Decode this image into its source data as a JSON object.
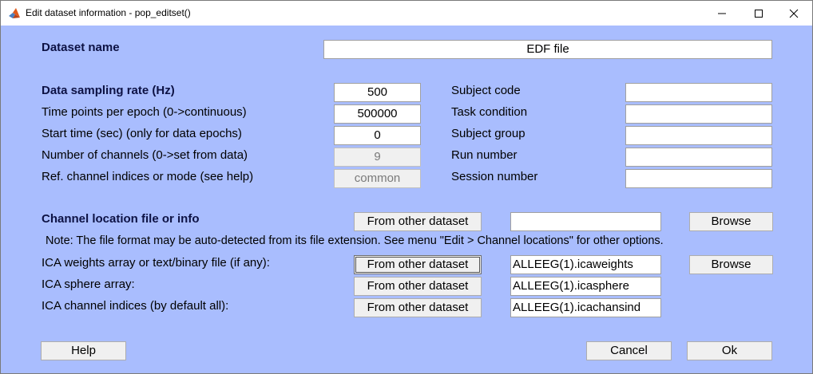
{
  "window": {
    "title": "Edit dataset information - pop_editset()"
  },
  "dataset_name": {
    "label": "Dataset name",
    "value": "EDF file"
  },
  "params": [
    {
      "label": "Data sampling rate (Hz)",
      "value": "500"
    },
    {
      "label": "Time points per epoch (0->continuous)",
      "value": "500000"
    },
    {
      "label": "Start time (sec) (only for data epochs)",
      "value": "0"
    },
    {
      "label": "Number of channels (0->set from data)",
      "value": "9"
    },
    {
      "label": "Ref. channel indices or mode (see help)",
      "value": "common"
    }
  ],
  "subject_info": [
    {
      "label": "Subject code",
      "value": ""
    },
    {
      "label": "Task condition",
      "value": ""
    },
    {
      "label": "Subject group",
      "value": ""
    },
    {
      "label": "Run number",
      "value": ""
    },
    {
      "label": "Session number",
      "value": ""
    }
  ],
  "chanlocs": {
    "label": "Channel location file or info",
    "from_other_label": "From other dataset",
    "value": "",
    "browse_label": "Browse",
    "note": "Note: The file format may be auto-detected from its file extension. See menu \"Edit > Channel locations\" for other options."
  },
  "ica": [
    {
      "label": "ICA weights array or text/binary file (if any):",
      "from_other_label": "From other dataset",
      "value": "ALLEEG(1).icaweights",
      "browse_label": "Browse"
    },
    {
      "label": "ICA sphere array:",
      "from_other_label": "From other dataset",
      "value": "ALLEEG(1).icasphere"
    },
    {
      "label": "ICA channel indices (by default all):",
      "from_other_label": "From other dataset",
      "value": "ALLEEG(1).icachansind"
    }
  ],
  "buttons": {
    "help": "Help",
    "cancel": "Cancel",
    "ok": "Ok"
  },
  "colors": {
    "background": "#a9bdfe",
    "label_bold": "#0d1244"
  }
}
